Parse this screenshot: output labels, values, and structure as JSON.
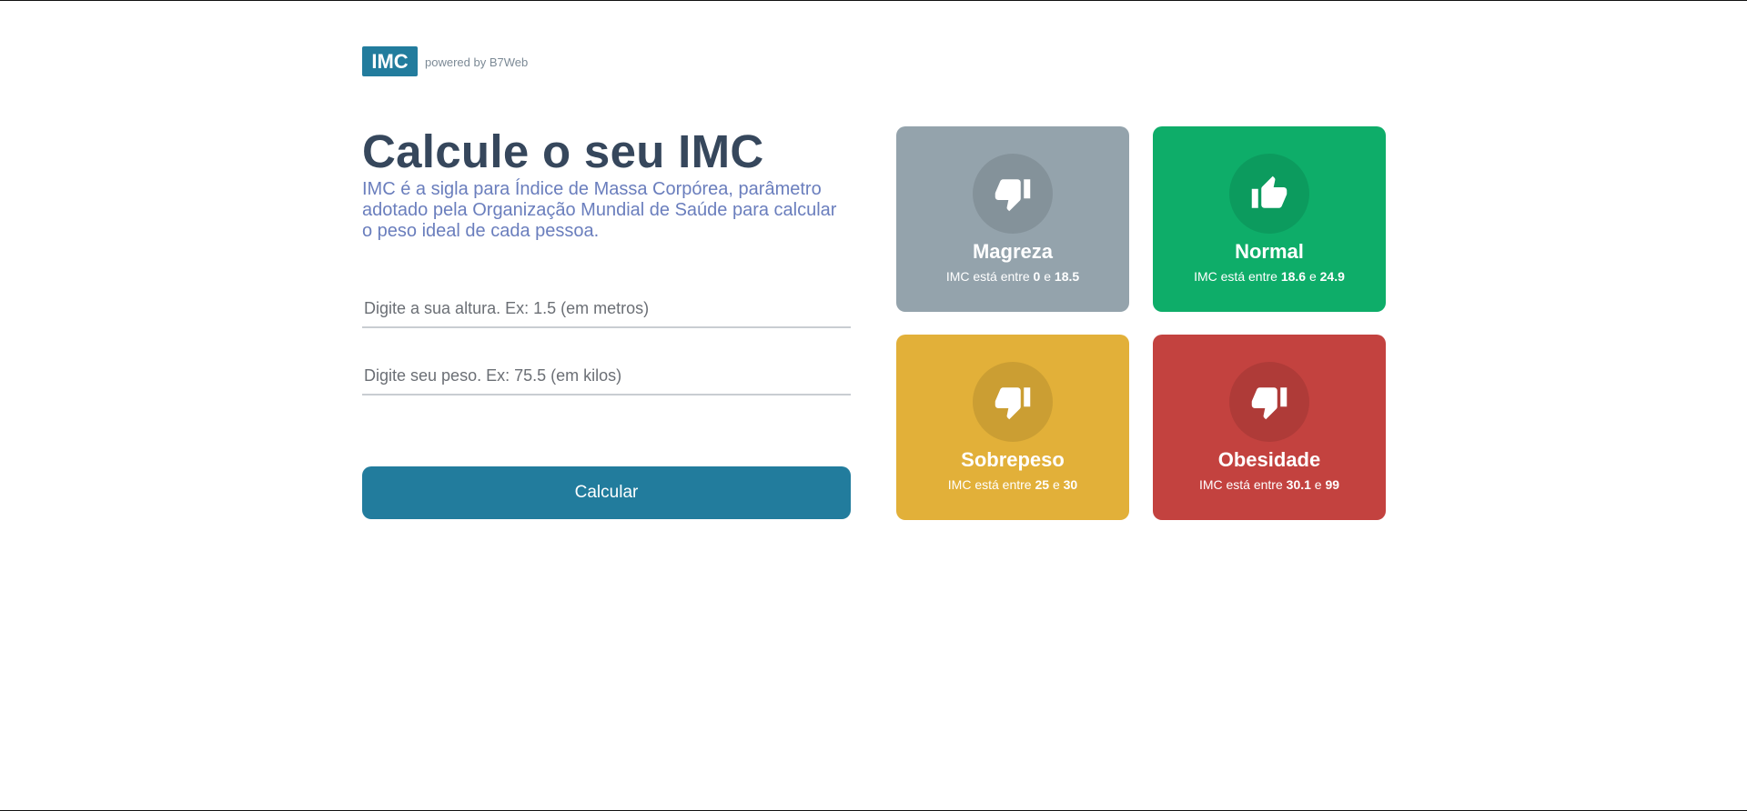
{
  "header": {
    "logo": "IMC",
    "powered": "powered by B7Web"
  },
  "main": {
    "title": "Calcule o seu IMC",
    "description": "IMC é a sigla para Índice de Massa Corpórea, parâmetro adotado pela Organização Mundial de Saúde para calcular o peso ideal de cada pessoa.",
    "height_input": {
      "value": "",
      "placeholder": "Digite a sua altura. Ex: 1.5 (em metros)"
    },
    "weight_input": {
      "value": "",
      "placeholder": "Digite seu peso. Ex: 75.5 (em kilos)"
    },
    "calc_label": "Calcular"
  },
  "levels": [
    {
      "title": "Magreza",
      "prefix": "IMC está entre",
      "min": "0",
      "joiner": "e",
      "max": "18.5",
      "color": "#94A3AC",
      "icon": "thumbs-down-icon"
    },
    {
      "title": "Normal",
      "prefix": "IMC está entre",
      "min": "18.6",
      "joiner": "e",
      "max": "24.9",
      "color": "#0EAD69",
      "icon": "thumbs-up-icon"
    },
    {
      "title": "Sobrepeso",
      "prefix": "IMC está entre",
      "min": "25",
      "joiner": "e",
      "max": "30",
      "color": "#E2B039",
      "icon": "thumbs-down-icon"
    },
    {
      "title": "Obesidade",
      "prefix": "IMC está entre",
      "min": "30.1",
      "joiner": "e",
      "max": "99",
      "color": "#C3423F",
      "icon": "thumbs-down-icon"
    }
  ]
}
